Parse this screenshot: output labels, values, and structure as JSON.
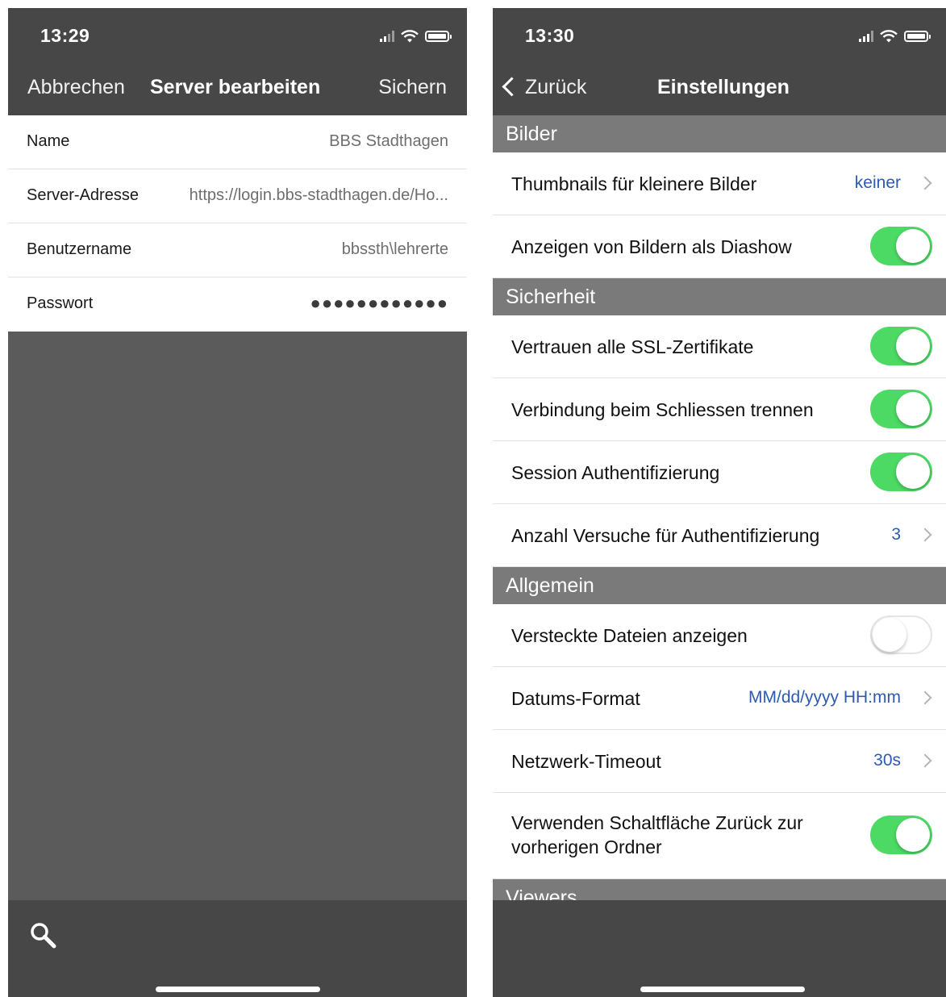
{
  "left": {
    "status": {
      "time": "13:29"
    },
    "nav": {
      "cancel": "Abbrechen",
      "title": "Server bearbeiten",
      "save": "Sichern"
    },
    "fields": [
      {
        "label": "Name",
        "value": "BBS Stadthagen"
      },
      {
        "label": "Server-Adresse",
        "value": "https://login.bbs-stadthagen.de/Ho..."
      },
      {
        "label": "Benutzername",
        "value": "bbssth\\lehrerte"
      },
      {
        "label": "Passwort",
        "value": "●●●●●●●●●●●●"
      }
    ],
    "bottom": {
      "icon": "search-icon"
    }
  },
  "right": {
    "status": {
      "time": "13:30"
    },
    "nav": {
      "back": "Zurück",
      "title": "Einstellungen"
    },
    "sections": {
      "bilder": "Bilder",
      "sicherheit": "Sicherheit",
      "allgemein": "Allgemein",
      "viewers": "Viewers"
    },
    "rows": {
      "thumbnails": {
        "label": "Thumbnails für kleinere Bilder",
        "value": "keiner"
      },
      "diashow": {
        "label": "Anzeigen von Bildern als Diashow",
        "on": true
      },
      "ssl": {
        "label": "Vertrauen alle SSL-Zertifikate",
        "on": true
      },
      "disconnect": {
        "label": "Verbindung beim Schliessen trennen",
        "on": true
      },
      "session": {
        "label": "Session Authentifizierung",
        "on": true
      },
      "attempts": {
        "label": "Anzahl Versuche für Authentifizierung",
        "value": "3"
      },
      "hidden": {
        "label": "Versteckte Dateien anzeigen",
        "on": false
      },
      "dateformat": {
        "label": "Datums-Format",
        "value": "MM/dd/yyyy HH:mm"
      },
      "timeout": {
        "label": "Netzwerk-Timeout",
        "value": "30s"
      },
      "backbutton": {
        "label": "Verwenden Schaltfläche Zurück zur vorherigen Ordner",
        "on": true
      }
    }
  },
  "colors": {
    "toggle_on": "#4cd964",
    "value_blue": "#2d5bb0",
    "bar_dark": "#474747",
    "section_gray": "#7a7a7a"
  }
}
